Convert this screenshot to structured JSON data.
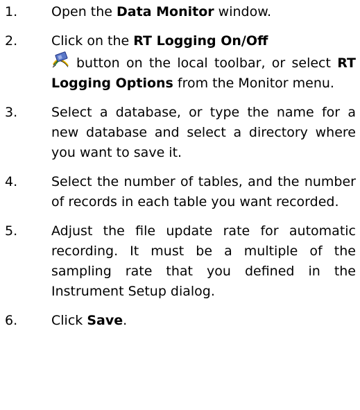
{
  "steps": [
    {
      "number": "1.",
      "before": "Open the ",
      "bold": "Data Monitor",
      "after": " window."
    },
    {
      "number": "2.",
      "before": "Click on the ",
      "bold": "RT Logging On/Off",
      "icon": "rt-logging-toggle-icon",
      "middle": "button on the local toolbar, or select ",
      "bold2": "RT Logging Options",
      "after": " from the Monitor menu."
    },
    {
      "number": "3.",
      "text": "Select a database, or type the name for a new database and select a directory where you want to save it."
    },
    {
      "number": "4.",
      "text": "Select the number of tables, and the number of records in each table you want recorded."
    },
    {
      "number": "5.",
      "text": "Adjust the file update rate for automatic recording. It must be a multiple of the sampling rate that you defined in the Instrument Setup dialog."
    },
    {
      "number": "6.",
      "before": "Click ",
      "bold": "Save",
      "after": "."
    }
  ]
}
